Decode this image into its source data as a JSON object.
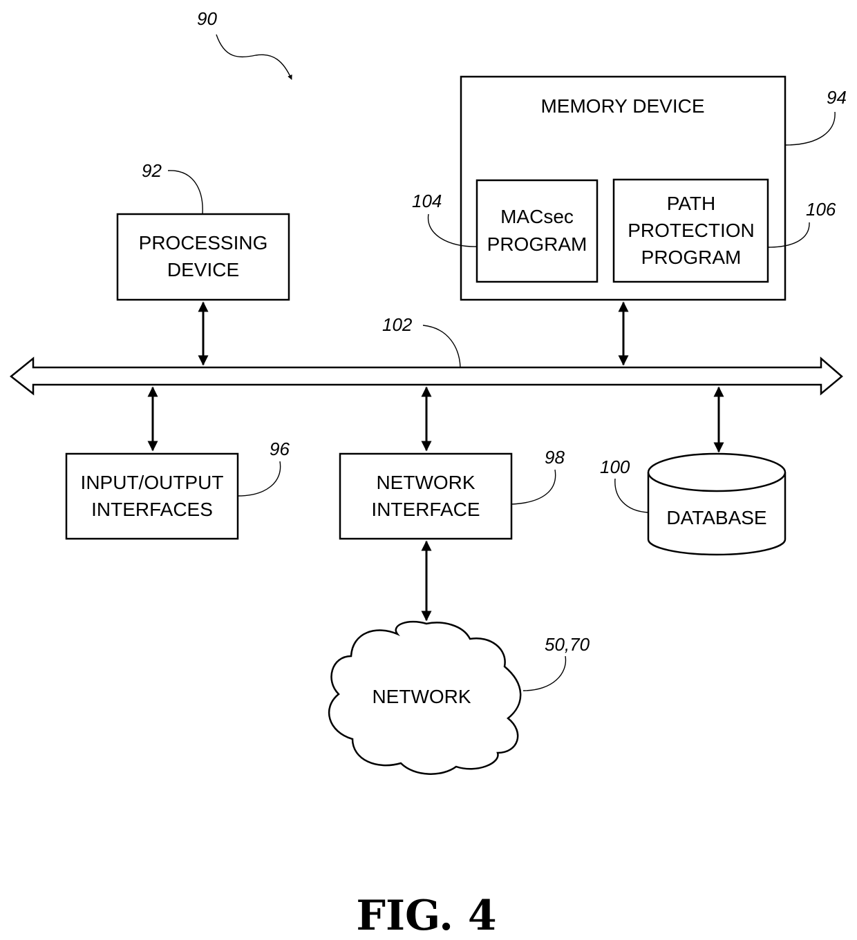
{
  "figure": {
    "caption": "FIG. 4",
    "system_ref": "90"
  },
  "blocks": {
    "processing": {
      "ref": "92",
      "lines": [
        "PROCESSING",
        "DEVICE"
      ]
    },
    "memory": {
      "ref": "94",
      "title": "MEMORY DEVICE"
    },
    "macsec": {
      "ref": "104",
      "lines": [
        "MACsec",
        "PROGRAM"
      ]
    },
    "path_protection": {
      "ref": "106",
      "lines": [
        "PATH",
        "PROTECTION",
        "PROGRAM"
      ]
    },
    "bus": {
      "ref": "102"
    },
    "io": {
      "ref": "96",
      "lines": [
        "INPUT/OUTPUT",
        "INTERFACES"
      ]
    },
    "network_interface": {
      "ref": "98",
      "lines": [
        "NETWORK",
        "INTERFACE"
      ]
    },
    "database": {
      "ref": "100",
      "label": "DATABASE"
    },
    "network": {
      "ref": "50,70",
      "label": "NETWORK"
    }
  }
}
